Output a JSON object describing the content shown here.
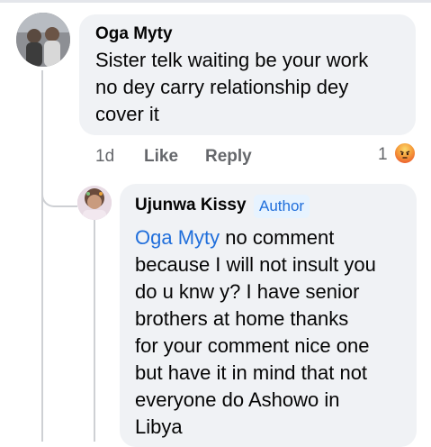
{
  "comment": {
    "author": "Oga Myty",
    "text_lines": [
      "Sister telk waiting be your work",
      "no dey carry relationship dey",
      "cover it"
    ],
    "time": "1d",
    "like_label": "Like",
    "reply_label": "Reply",
    "reaction_count": "1",
    "reaction_icon": "angry-reaction-icon",
    "reaction_color": "#e8452a"
  },
  "reply": {
    "author": "Ujunwa Kissy",
    "badge": "Author",
    "mention": "Oga Myty",
    "text_lines": [
      " no comment",
      "because I will not insult you",
      "do u knw y? I have senior",
      "brothers at home thanks",
      "for your comment nice one",
      "but have it in mind that not",
      "everyone do Ashowo in",
      "Libya"
    ]
  },
  "colors": {
    "bubble_bg": "#f0f2f5",
    "link": "#216fdb",
    "secondary_text": "#65676b",
    "thread_line": "#ced0d4"
  }
}
